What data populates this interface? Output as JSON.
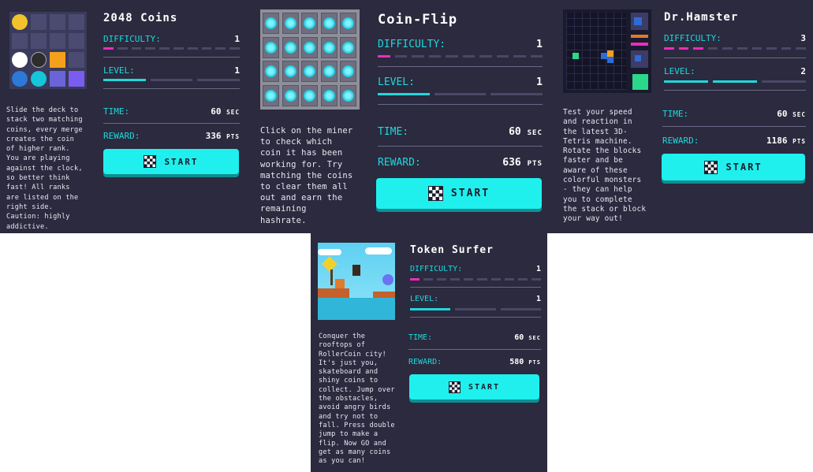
{
  "games": [
    {
      "title": "2048 Coins",
      "description": "Slide the deck to\nstack two matching\ncoins, every merge\ncreates the coin\nof higher rank.\nYou are playing\nagainst the clock,\nso better think\nfast! All ranks\nare listed on the\nright side.\nCaution: highly\naddictive.",
      "difficulty_label": "DIFFICULTY:",
      "difficulty": "1",
      "level_label": "LEVEL:",
      "level": "1",
      "time_label": "TIME:",
      "time_value": "60",
      "time_unit": "SEC",
      "reward_label": "REWARD:",
      "reward_value": "336",
      "reward_unit": "PTS",
      "start_label": "START"
    },
    {
      "title": "Coin-Flip",
      "description": "Click on the miner\nto check which\ncoin it has been\nworking for. Try\nmatching the coins\nto clear them all\nout and earn the\nremaining\nhashrate.",
      "difficulty_label": "DIFFICULTY:",
      "difficulty": "1",
      "level_label": "LEVEL:",
      "level": "1",
      "time_label": "TIME:",
      "time_value": "60",
      "time_unit": "SEC",
      "reward_label": "REWARD:",
      "reward_value": "636",
      "reward_unit": "PTS",
      "start_label": "START"
    },
    {
      "title": "Dr.Hamster",
      "description": "Test your speed\nand reaction in\nthe latest 3D-\nTetris machine.\nRotate the blocks\nfaster and be\naware of these\ncolorful monsters\n- they can help\nyou to complete\nthe stack or block\nyour way out!",
      "difficulty_label": "DIFFICULTY:",
      "difficulty": "3",
      "level_label": "LEVEL:",
      "level": "2",
      "time_label": "TIME:",
      "time_value": "60",
      "time_unit": "SEC",
      "reward_label": "REWARD:",
      "reward_value": "1186",
      "reward_unit": "PTS",
      "start_label": "START"
    },
    {
      "title": "Token Surfer",
      "description": "Conquer the\nrooftops of\nRollerCoin city!\nIt's just you,\nskateboard and\nshiny coins to\ncollect. Jump over\nthe obstacles,\navoid angry birds\nand try not to\nfall. Press double\njump to make a\nflip. Now GO and\nget as many coins\nas you can!",
      "difficulty_label": "DIFFICULTY:",
      "difficulty": "1",
      "level_label": "LEVEL:",
      "level": "1",
      "time_label": "TIME:",
      "time_value": "60",
      "time_unit": "SEC",
      "reward_label": "REWARD:",
      "reward_value": "580",
      "reward_unit": "PTS",
      "start_label": "START"
    }
  ],
  "colors": {
    "background": "#2b2a3e",
    "accent_cyan": "#1fd8dc",
    "accent_pink": "#ea2dbd",
    "button": "#1ff0ee"
  },
  "icons": [
    "checkered-flag-icon"
  ]
}
